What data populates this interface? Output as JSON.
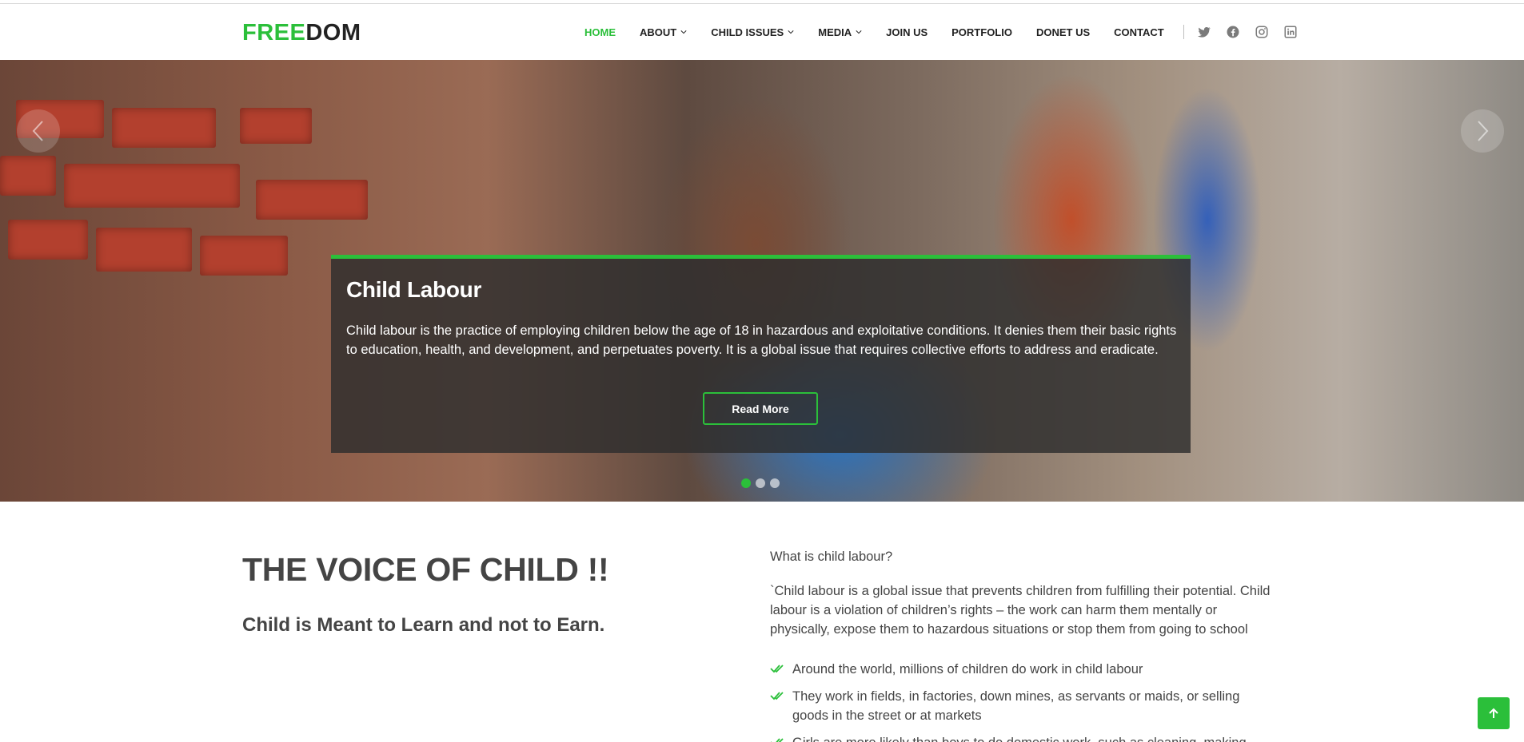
{
  "logo": {
    "part_a": "FREE",
    "part_b": "DOM"
  },
  "nav": {
    "items": [
      {
        "label": "HOME",
        "active": true,
        "dropdown": false
      },
      {
        "label": "ABOUT",
        "active": false,
        "dropdown": true
      },
      {
        "label": "CHILD ISSUES",
        "active": false,
        "dropdown": true
      },
      {
        "label": "MEDIA",
        "active": false,
        "dropdown": true
      },
      {
        "label": "JOIN US",
        "active": false,
        "dropdown": false
      },
      {
        "label": "PORTFOLIO",
        "active": false,
        "dropdown": false
      },
      {
        "label": "DONET US",
        "active": false,
        "dropdown": false
      },
      {
        "label": "CONTACT",
        "active": false,
        "dropdown": false
      }
    ],
    "social_icons": [
      "twitter-icon",
      "facebook-icon",
      "instagram-icon",
      "linkedin-icon"
    ]
  },
  "hero": {
    "caption_title": "Child Labour",
    "caption_text": "Child labour is the practice of employing children below the age of 18 in hazardous and exploitative conditions. It denies them their basic rights to education, health, and development, and perpetuates poverty. It is a global issue that requires collective efforts to address and eradicate.",
    "button_label": "Read More",
    "slide_count": 3,
    "active_slide": 1
  },
  "about": {
    "title": "THE VOICE OF CHILD !!",
    "subtitle": "Child is Meant to Learn and not to Earn.",
    "question": "What is child labour?",
    "paragraph": "`Child labour is a global issue that prevents children from fulfilling their potential. Child labour is a violation of children’s rights – the work can harm them mentally or physically, expose them to hazardous situations or stop them from going to school",
    "bullets": [
      "Around the world, millions of children do work in child labour",
      "They work in fields, in factories, down mines, as servants or maids, or selling goods in the street or at markets",
      "Girls are more likely than boys to do domestic work, such as cleaning, making"
    ]
  },
  "colors": {
    "accent": "#2bbf3a",
    "text": "#444444",
    "caption_bg": "#2d2d2d"
  }
}
